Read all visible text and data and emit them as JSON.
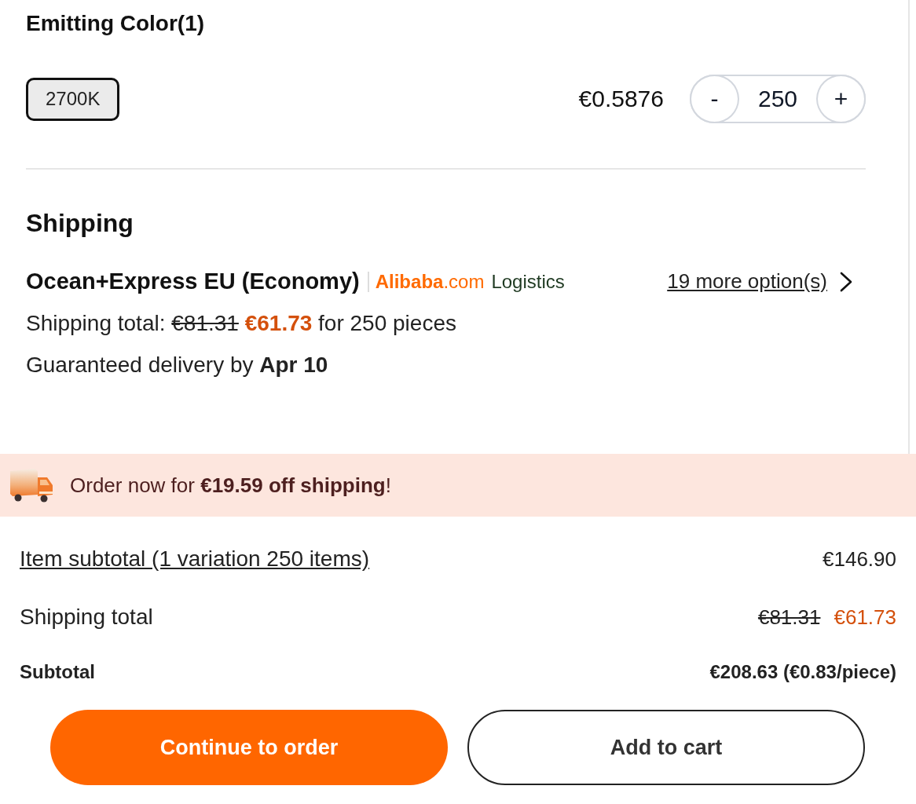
{
  "variant_section": {
    "title": "Emitting Color(1)",
    "options": [
      {
        "label": "2700K",
        "selected": true
      }
    ],
    "unit_price": "€0.5876",
    "quantity": {
      "decrement": "-",
      "value": "250",
      "increment": "+"
    }
  },
  "shipping": {
    "title": "Shipping",
    "method": "Ocean+Express EU (Economy)",
    "carrier_logo": {
      "brand": "Alibaba",
      "domain": ".com",
      "service": "Logistics"
    },
    "more_options": "19 more option(s)",
    "total": {
      "label": "Shipping total:",
      "original_price": "€81.31",
      "price": "€61.73",
      "suffix": "for 250 pieces"
    },
    "delivery": "Guaranteed delivery by **Apr 10**"
  },
  "promo_banner": {
    "text": "Order now for **€19.59 off shipping**!"
  },
  "summary": {
    "rows": [
      {
        "kind": "link",
        "label": "Item subtotal (1 variation 250 items)",
        "value": "€146.90"
      },
      {
        "kind": "discount",
        "label": "Shipping total",
        "original_value": "€81.31",
        "value": "€61.73"
      },
      {
        "kind": "total",
        "label": "Subtotal",
        "value": "€208.63 (€0.83/piece)"
      }
    ]
  },
  "actions": [
    {
      "kind": "primary",
      "label": "Continue to order"
    },
    {
      "kind": "secondary",
      "label": "Add to cart"
    }
  ]
}
